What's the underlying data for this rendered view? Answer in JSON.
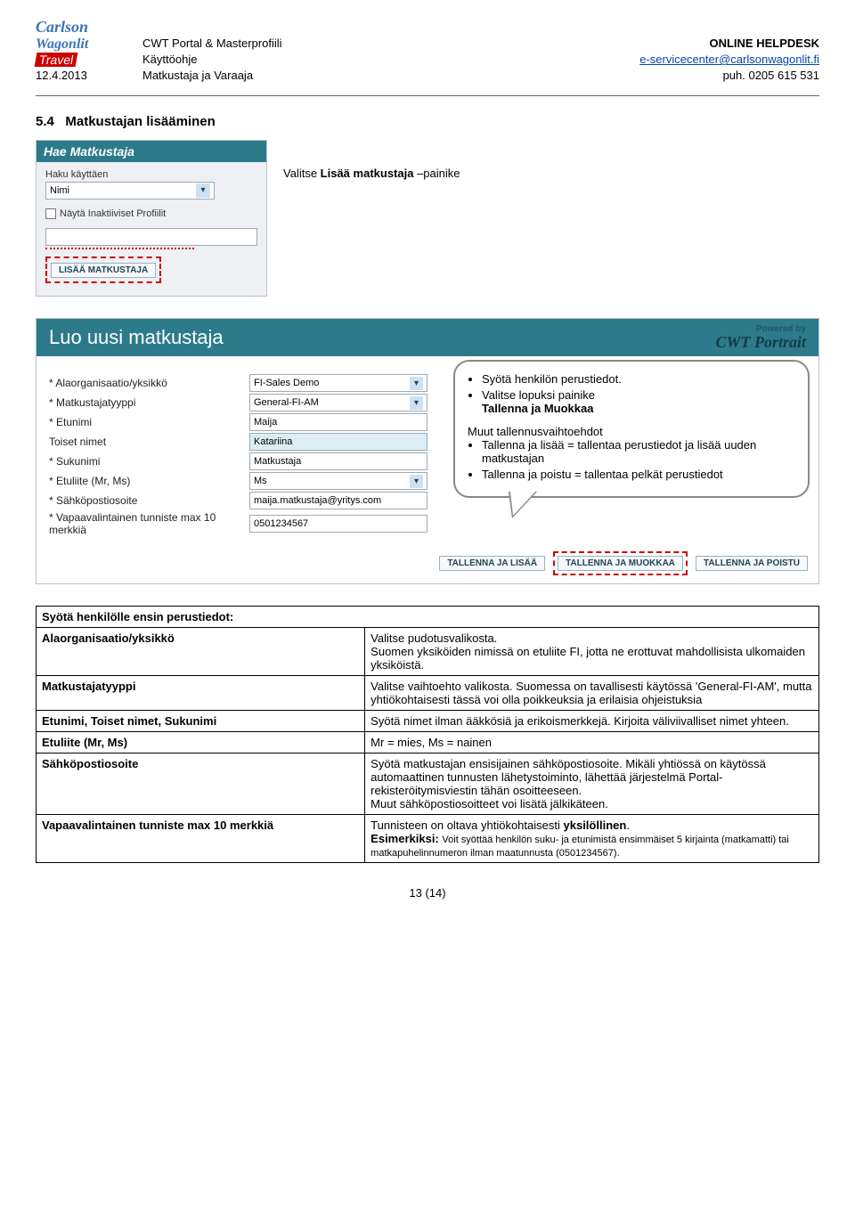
{
  "header": {
    "left": {
      "line1": "CWT Portal & Masterprofiili",
      "line2": "Käyttöohje",
      "line3": "Matkustaja ja Varaaja"
    },
    "right": {
      "helpdesk": "ONLINE HELPDESK",
      "email": "e-servicecenter@carlsonwagonlit.fi",
      "phone": "puh. 0205 615 531"
    },
    "date": "12.4.2013"
  },
  "section": {
    "number": "5.4",
    "title": "Matkustajan lisääminen"
  },
  "smallbox": {
    "title": "Hae Matkustaja",
    "search_label": "Haku käyttäen",
    "select_value": "Nimi",
    "checkbox_label": "Näytä Inaktiiviset Profiilit",
    "button_label": "LISÄÄ MATKUSTAJA"
  },
  "instr1_pre": "Valitse ",
  "instr1_bold": "Lisää matkustaja",
  "instr1_post": " –painike",
  "bigbox": {
    "title": "Luo uusi matkustaja",
    "powered_pre": "Powered by",
    "powered_brand": "CWT Portrait",
    "fields": [
      {
        "label": "Alaorganisaatio/yksikkö",
        "req": true,
        "type": "select",
        "value": "FI-Sales Demo"
      },
      {
        "label": "Matkustajatyyppi",
        "req": true,
        "type": "select",
        "value": "General-FI-AM"
      },
      {
        "label": "Etunimi",
        "req": true,
        "type": "input",
        "value": "Maija"
      },
      {
        "label": "Toiset nimet",
        "req": false,
        "type": "input",
        "value": "Katariina",
        "hl": true
      },
      {
        "label": "Sukunimi",
        "req": true,
        "type": "input",
        "value": "Matkustaja"
      },
      {
        "label": "Etuliite (Mr, Ms)",
        "req": true,
        "type": "select",
        "value": "Ms"
      },
      {
        "label": "Sähköpostiosoite",
        "req": true,
        "type": "input",
        "value": "maija.matkustaja@yritys.com"
      },
      {
        "label": "Vapaavalintainen tunniste max 10 merkkiä",
        "req": true,
        "type": "input",
        "value": "0501234567"
      }
    ],
    "buttons": {
      "b1": "TALLENNA JA LISÄÄ",
      "b2": "TALLENNA JA MUOKKAA",
      "b3": "TALLENNA JA POISTU"
    }
  },
  "callout": {
    "l1": "Syötä henkilön perustiedot.",
    "l2a": "Valitse lopuksi painike",
    "l2b": "Tallenna ja Muokkaa",
    "sub_title": "Muut tallennusvaihtoehdot",
    "s1": "Tallenna ja lisää = tallentaa perustiedot ja lisää uuden matkustajan",
    "s2": "Tallenna ja poistu = tallentaa pelkät perustiedot"
  },
  "table": {
    "captionrow": "Syötä henkilölle ensin perustiedot:",
    "rows": [
      {
        "k": "Alaorganisaatio/yksikkö",
        "v": "Valitse pudotusvalikosta.\nSuomen yksiköiden nimissä on etuliite FI, jotta ne erottuvat mahdollisista ulkomaiden yksiköistä."
      },
      {
        "k": "Matkustajatyyppi",
        "v": "Valitse vaihtoehto valikosta. Suomessa on tavallisesti käytössä 'General-FI-AM', mutta yhtiökohtaisesti tässä  voi olla poikkeuksia ja erilaisia ohjeistuksia"
      },
      {
        "k": "Etunimi, Toiset nimet, Sukunimi",
        "v": "Syötä nimet ilman ääkkösiä ja erikoismerkkejä. Kirjoita väliviivalliset nimet yhteen."
      },
      {
        "k": "Etuliite (Mr, Ms)",
        "v": "Mr = mies, Ms = nainen"
      },
      {
        "k": "Sähköpostiosoite",
        "v": "Syötä matkustajan ensisijainen sähköpostiosoite. Mikäli yhtiössä on käytössä automaattinen tunnusten lähetystoiminto, lähettää järjestelmä Portal-rekisteröitymisviestin tähän osoitteeseen.\nMuut sähköpostiosoitteet voi lisätä jälkikäteen."
      },
      {
        "k": "Vapaavalintainen tunniste max 10 merkkiä",
        "v_html": "Tunnisteen on oltava yhtiökohtaisesti <b>yksilöllinen</b>.<br><b>Esimerkiksi:</b> <span style='font-size:11px'>Voit syöttää henkilön suku- ja etunimistä ensimmäiset 5 kirjainta (matkamatti) tai matkapuhelinnumeron ilman maatunnusta (0501234567).</span>"
      }
    ]
  },
  "footer": {
    "pagenum": "13 (14)"
  }
}
